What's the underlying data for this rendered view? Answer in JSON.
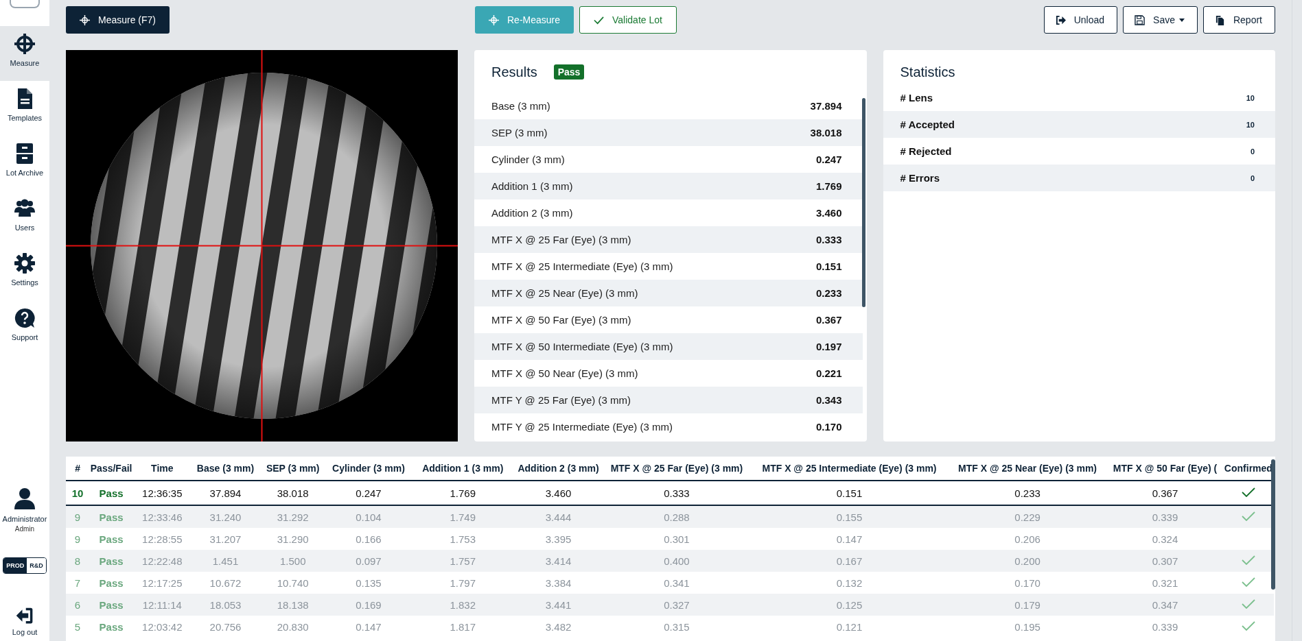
{
  "sidebar": {
    "items": [
      {
        "label": "Measure",
        "selected": true
      },
      {
        "label": "Templates",
        "selected": false
      },
      {
        "label": "Lot Archive",
        "selected": false
      },
      {
        "label": "Users",
        "selected": false
      },
      {
        "label": "Settings",
        "selected": false
      },
      {
        "label": "Support",
        "selected": false
      }
    ],
    "user": {
      "name": "Administrator",
      "role": "Admin"
    },
    "mode_toggle": [
      {
        "label": "PROD",
        "selected": true
      },
      {
        "label": "R&D",
        "selected": false
      }
    ],
    "logout": "Log out"
  },
  "toolbar": {
    "measure": "Measure (F7)",
    "remeasure": "Re-Measure",
    "validate": "Validate Lot",
    "unload": "Unload",
    "save": "Save",
    "report": "Report"
  },
  "results": {
    "title": "Results",
    "status": "Pass",
    "rows": [
      {
        "label": "Base (3 mm)",
        "value": "37.894"
      },
      {
        "label": "SEP (3 mm)",
        "value": "38.018"
      },
      {
        "label": "Cylinder (3 mm)",
        "value": "0.247"
      },
      {
        "label": "Addition 1 (3 mm)",
        "value": "1.769"
      },
      {
        "label": "Addition 2 (3 mm)",
        "value": "3.460"
      },
      {
        "label": "MTF X @ 25 Far (Eye) (3 mm)",
        "value": "0.333"
      },
      {
        "label": "MTF X @ 25 Intermediate (Eye) (3 mm)",
        "value": "0.151"
      },
      {
        "label": "MTF X @ 25 Near (Eye) (3 mm)",
        "value": "0.233"
      },
      {
        "label": "MTF X @ 50 Far (Eye) (3 mm)",
        "value": "0.367"
      },
      {
        "label": "MTF X @ 50 Intermediate (Eye) (3 mm)",
        "value": "0.197"
      },
      {
        "label": "MTF X @ 50 Near (Eye) (3 mm)",
        "value": "0.221"
      },
      {
        "label": "MTF Y @ 25 Far (Eye) (3 mm)",
        "value": "0.343"
      },
      {
        "label": "MTF Y @ 25 Intermediate (Eye) (3 mm)",
        "value": "0.170"
      }
    ]
  },
  "statistics": {
    "title": "Statistics",
    "rows": [
      {
        "label": "# Lens",
        "value": "10"
      },
      {
        "label": "# Accepted",
        "value": "10"
      },
      {
        "label": "# Rejected",
        "value": "0"
      },
      {
        "label": "# Errors",
        "value": "0"
      }
    ]
  },
  "table": {
    "columns": [
      "#",
      "Pass/Fail",
      "Time",
      "Base (3 mm)",
      "SEP (3 mm)",
      "Cylinder (3 mm)",
      "Addition 1 (3 mm)",
      "Addition 2 (3 mm)",
      "MTF X @ 25 Far (Eye) (3 mm)",
      "MTF X @ 25 Intermediate (Eye) (3 mm)",
      "MTF X @ 25 Near (Eye) (3 mm)",
      "MTF X @ 50 Far (Eye) (",
      "Confirmed"
    ],
    "rows": [
      {
        "selected": true,
        "confirmed": true,
        "cells": [
          "10",
          "Pass",
          "12:36:35",
          "37.894",
          "38.018",
          "0.247",
          "1.769",
          "3.460",
          "0.333",
          "0.151",
          "0.233",
          "0.367"
        ]
      },
      {
        "selected": false,
        "confirmed": true,
        "cells": [
          "9",
          "Pass",
          "12:33:46",
          "31.240",
          "31.292",
          "0.104",
          "1.749",
          "3.444",
          "0.288",
          "0.155",
          "0.229",
          "0.339"
        ]
      },
      {
        "selected": false,
        "confirmed": false,
        "cells": [
          "9",
          "Pass",
          "12:28:55",
          "31.207",
          "31.290",
          "0.166",
          "1.753",
          "3.395",
          "0.301",
          "0.147",
          "0.206",
          "0.324"
        ]
      },
      {
        "selected": false,
        "confirmed": true,
        "cells": [
          "8",
          "Pass",
          "12:22:48",
          "1.451",
          "1.500",
          "0.097",
          "1.757",
          "3.414",
          "0.400",
          "0.167",
          "0.200",
          "0.307"
        ]
      },
      {
        "selected": false,
        "confirmed": true,
        "cells": [
          "7",
          "Pass",
          "12:17:25",
          "10.672",
          "10.740",
          "0.135",
          "1.797",
          "3.384",
          "0.341",
          "0.132",
          "0.170",
          "0.321"
        ]
      },
      {
        "selected": false,
        "confirmed": true,
        "cells": [
          "6",
          "Pass",
          "12:11:14",
          "18.053",
          "18.138",
          "0.169",
          "1.832",
          "3.441",
          "0.327",
          "0.125",
          "0.179",
          "0.347"
        ]
      },
      {
        "selected": false,
        "confirmed": true,
        "cells": [
          "5",
          "Pass",
          "12:03:42",
          "20.756",
          "20.830",
          "0.147",
          "1.817",
          "3.482",
          "0.315",
          "0.121",
          "0.195",
          "0.339"
        ]
      }
    ]
  }
}
